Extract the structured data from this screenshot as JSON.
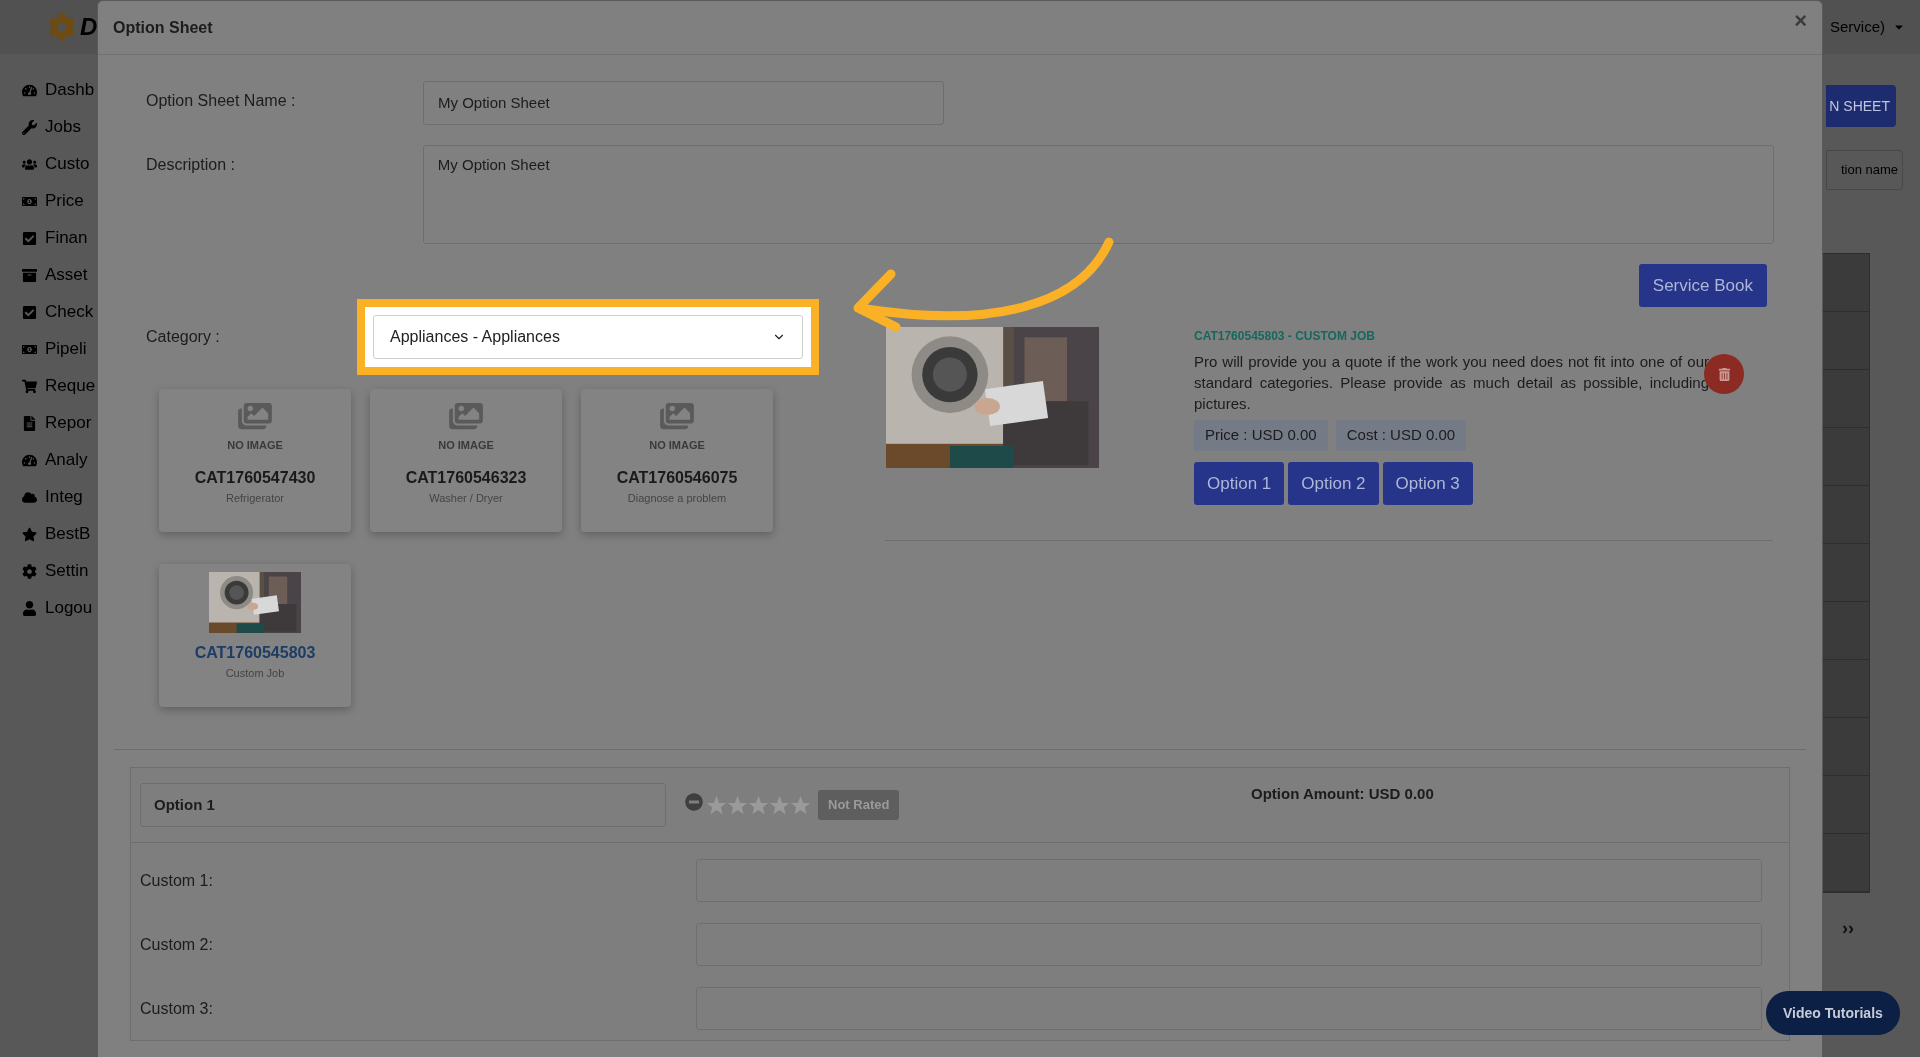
{
  "background_page": {
    "logo_text": "D",
    "account_menu": "Service)",
    "add_button": "N SHEET",
    "search": {
      "placeholder": "tion name"
    },
    "pager": "››",
    "sidebar": {
      "items": [
        {
          "label": "Dashb"
        },
        {
          "label": "Jobs"
        },
        {
          "label": "Custo"
        },
        {
          "label": "Price"
        },
        {
          "label": "Finan"
        },
        {
          "label": "Asset"
        },
        {
          "label": "Check"
        },
        {
          "label": "Pipeli"
        },
        {
          "label": "Reque"
        },
        {
          "label": "Repor"
        },
        {
          "label": "Analy"
        },
        {
          "label": "Integ"
        },
        {
          "label": "BestB"
        },
        {
          "label": "Settin"
        },
        {
          "label": "Logou"
        }
      ]
    }
  },
  "modal": {
    "title": "Option Sheet",
    "close": "×",
    "name_field": {
      "label": "Option Sheet Name :",
      "value": "My Option Sheet"
    },
    "description_field": {
      "label": "Description :",
      "value": "My Option Sheet"
    },
    "service_book_button": "Service Book",
    "category_field": {
      "label": "Category :",
      "value": "Appliances - Appliances",
      "highlighted": true
    },
    "categories": [
      {
        "kind": "no_image",
        "placeholder": "NO IMAGE",
        "code": "CAT1760547430",
        "name": "Refrigerator",
        "selected": false
      },
      {
        "kind": "no_image",
        "placeholder": "NO IMAGE",
        "code": "CAT1760546323",
        "name": "Washer / Dryer",
        "selected": false
      },
      {
        "kind": "no_image",
        "placeholder": "NO IMAGE",
        "code": "CAT1760546075",
        "name": "Diagnose a problem",
        "selected": false
      },
      {
        "kind": "picture",
        "code": "CAT1760545803",
        "name": "Custom Job",
        "selected": true
      }
    ],
    "detail": {
      "title": "CAT1760545803 - CUSTOM JOB",
      "description": "Pro will provide you a quote if the work you need does not fit into one of our standard categories. Please provide as much detail as possible, including pictures.",
      "price": "Price : USD 0.00",
      "cost": "Cost : USD 0.00",
      "option_buttons": [
        "Option 1",
        "Option 2",
        "Option 3"
      ]
    },
    "option_panel": {
      "name": "Option 1",
      "stars": 0,
      "rating_badge": "Not Rated",
      "amount": "Option Amount: USD 0.00",
      "custom_fields": [
        {
          "label": "Custom 1:"
        },
        {
          "label": "Custom 2:"
        },
        {
          "label": "Custom 3:"
        }
      ]
    }
  },
  "video_tutorials_button": "Video Tutorials"
}
